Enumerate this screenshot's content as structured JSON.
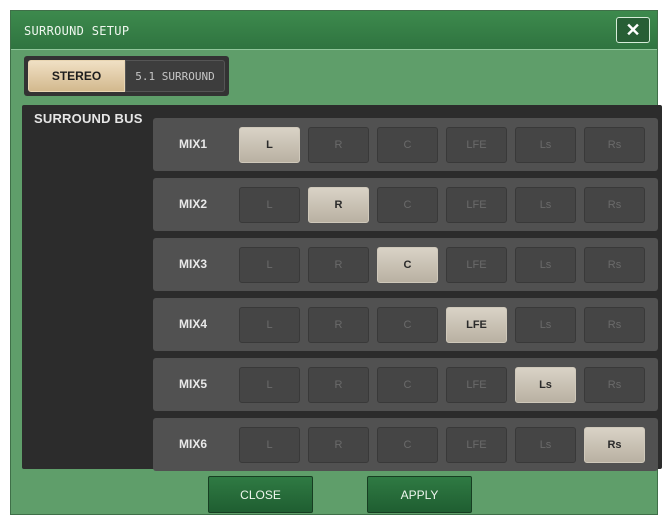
{
  "window": {
    "title": "SURROUND SETUP",
    "close_glyph": "✕"
  },
  "mode": {
    "stereo_label": "STEREO",
    "surround_label": "5.1 SURROUND",
    "selected": "STEREO"
  },
  "panel": {
    "label": "SURROUND BUS"
  },
  "channels": [
    "L",
    "R",
    "C",
    "LFE",
    "Ls",
    "Rs"
  ],
  "mixes": [
    {
      "label": "MIX1",
      "assigned": "L"
    },
    {
      "label": "MIX2",
      "assigned": "R"
    },
    {
      "label": "MIX3",
      "assigned": "C"
    },
    {
      "label": "MIX4",
      "assigned": "LFE"
    },
    {
      "label": "MIX5",
      "assigned": "Ls"
    },
    {
      "label": "MIX6",
      "assigned": "Rs"
    }
  ],
  "footer": {
    "close_label": "CLOSE",
    "apply_label": "APPLY"
  },
  "colors": {
    "window_bg": "#5f9e6a",
    "titlebar": "#2f7440",
    "selected_button": "#d3b98e",
    "panel_bg": "#2c2c2c"
  }
}
